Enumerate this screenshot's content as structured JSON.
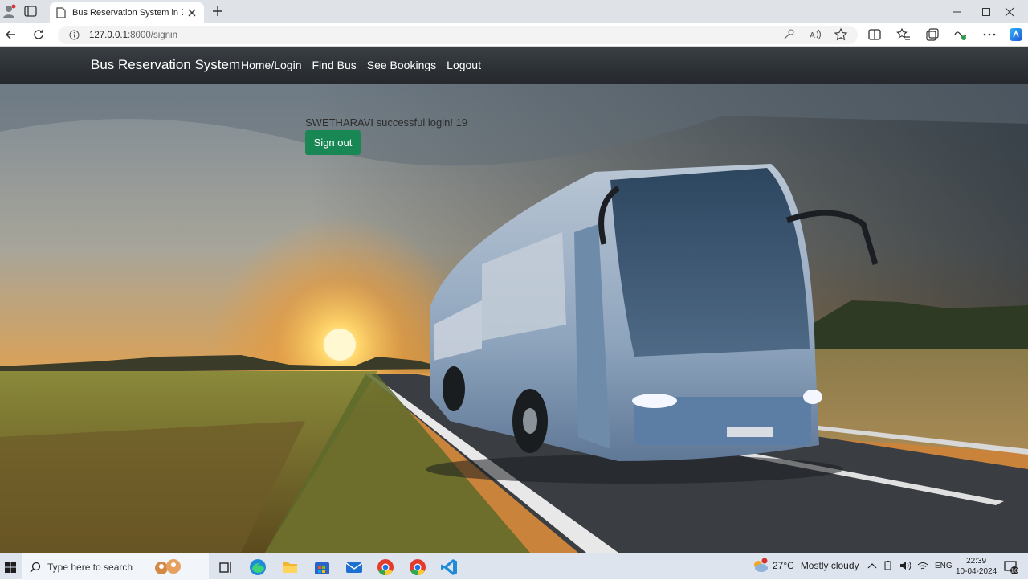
{
  "browser": {
    "tab_title": "Bus Reservation System in Djang",
    "url_host": "127.0.0.1",
    "url_rest": ":8000/signin"
  },
  "site": {
    "brand": "Bus Reservation System",
    "nav": [
      "Home/Login",
      "Find Bus",
      "See Bookings",
      "Logout"
    ],
    "login_message": "SWETHARAVI successful login! 19",
    "signout_label": "Sign out",
    "signout_color": "#198754"
  },
  "taskbar": {
    "search_placeholder": "Type here to search",
    "weather_temp": "27°C",
    "weather_text": "Mostly cloudy",
    "language": "ENG",
    "time": "22:39",
    "date": "10-04-2024",
    "notification_count": "10"
  }
}
